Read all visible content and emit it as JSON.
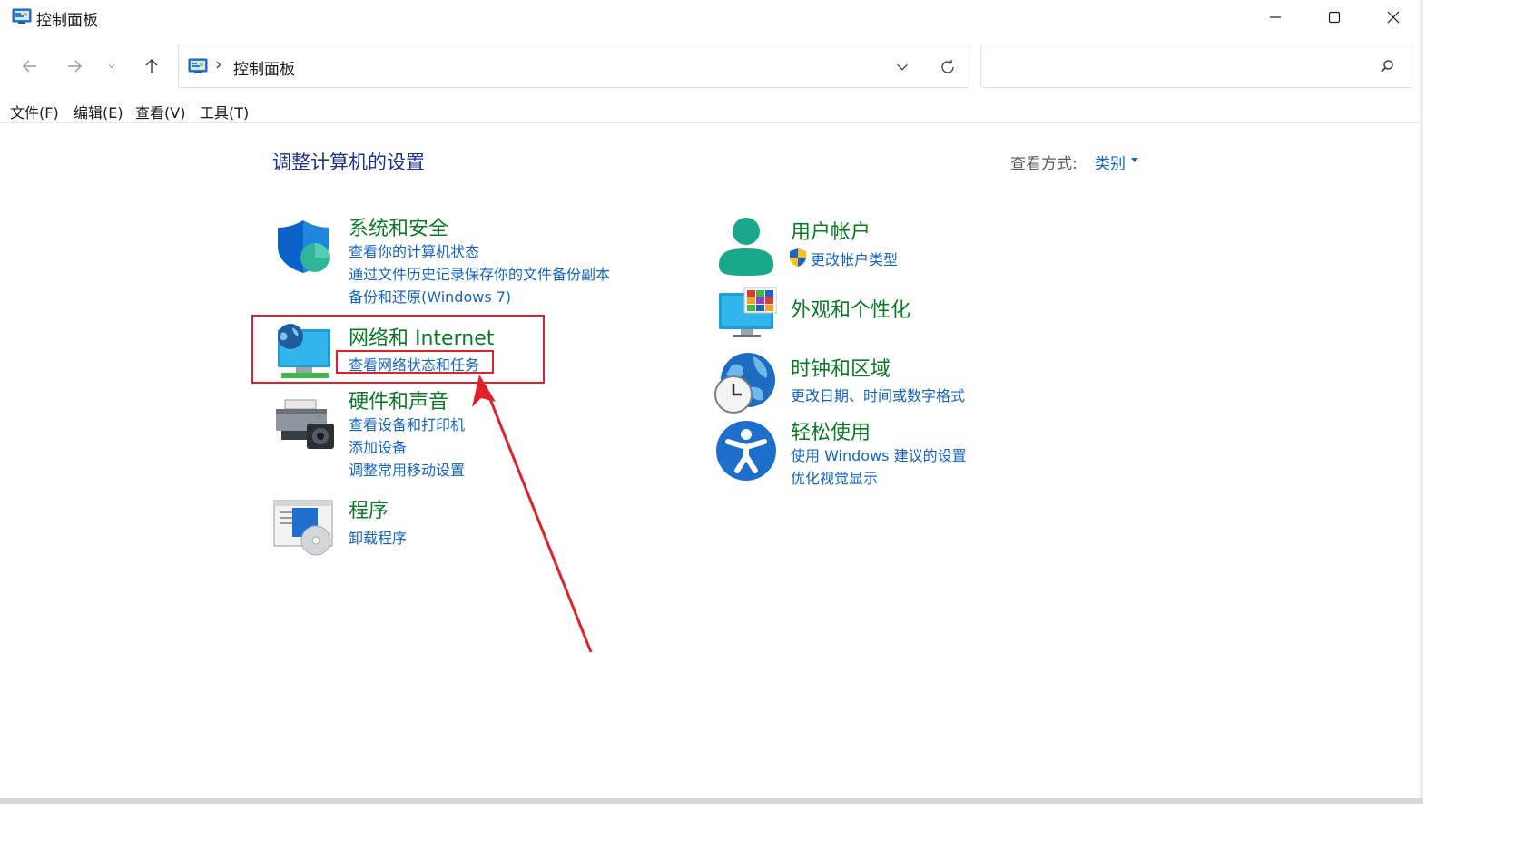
{
  "window": {
    "title": "控制面板",
    "controls": {
      "minimize": "minimize",
      "maximize": "maximize",
      "close": "close"
    }
  },
  "address_bar": {
    "separator": "›",
    "path": "控制面板"
  },
  "search": {
    "placeholder": "",
    "value": ""
  },
  "menu": {
    "items": [
      "文件(F)",
      "编辑(E)",
      "查看(V)",
      "工具(T)"
    ]
  },
  "main": {
    "page_title": "调整计算机的设置",
    "view_by_label": "查看方式:",
    "view_by_value": "类别"
  },
  "categories": [
    {
      "id": "system-security",
      "title": "系统和安全",
      "icon": "shield-icon",
      "links": [
        "查看你的计算机状态",
        "通过文件历史记录保存你的文件备份副本",
        "备份和还原(Windows 7)"
      ]
    },
    {
      "id": "network-internet",
      "title": "网络和 Internet",
      "icon": "network-monitor-icon",
      "links": [
        "查看网络状态和任务"
      ]
    },
    {
      "id": "hardware-sound",
      "title": "硬件和声音",
      "icon": "printer-speaker-icon",
      "links": [
        "查看设备和打印机",
        "添加设备",
        "调整常用移动设置"
      ]
    },
    {
      "id": "programs",
      "title": "程序",
      "icon": "programs-disc-icon",
      "links": [
        "卸载程序"
      ]
    },
    {
      "id": "user-accounts",
      "title": "用户帐户",
      "icon": "user-icon",
      "links": [
        "更改帐户类型"
      ]
    },
    {
      "id": "appearance",
      "title": "外观和个性化",
      "icon": "monitor-palette-icon",
      "links": []
    },
    {
      "id": "clock-region",
      "title": "时钟和区域",
      "icon": "globe-clock-icon",
      "links": [
        "更改日期、时间或数字格式"
      ]
    },
    {
      "id": "ease-of-access",
      "title": "轻松使用",
      "icon": "accessibility-icon",
      "links": [
        "使用 Windows 建议的设置",
        "优化视觉显示"
      ]
    }
  ],
  "colors": {
    "title_blue": "#1e3287",
    "category_green": "#0b7a25",
    "link_blue": "#1464c8",
    "annotation_red": "#e0202a"
  }
}
